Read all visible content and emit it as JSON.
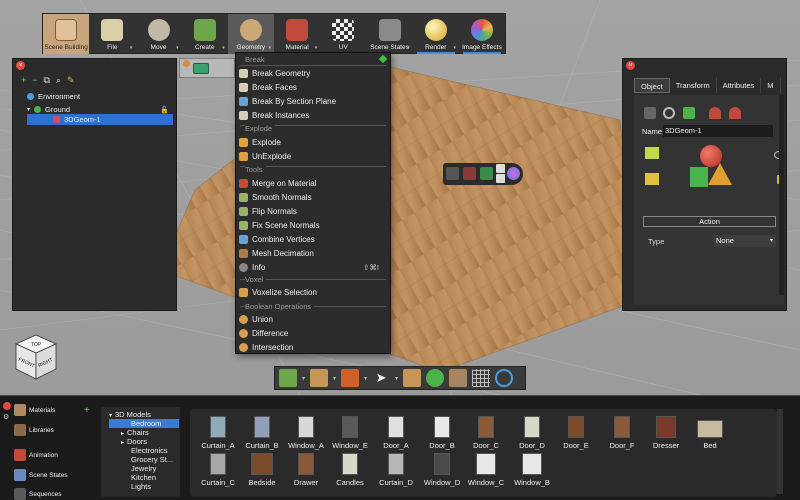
{
  "toolbar": {
    "items": [
      {
        "label": "Scene Building"
      },
      {
        "label": "File"
      },
      {
        "label": "Move"
      },
      {
        "label": "Create"
      },
      {
        "label": "Geometry"
      },
      {
        "label": "Material"
      },
      {
        "label": "UV"
      },
      {
        "label": "Scene States"
      },
      {
        "label": "Render"
      },
      {
        "label": "Image Effects"
      }
    ]
  },
  "scene": {
    "items": [
      {
        "label": "Environment"
      },
      {
        "label": "Ground"
      },
      {
        "label": "3DGeom-1"
      }
    ]
  },
  "menu": {
    "sections": [
      {
        "header": "Break",
        "items": [
          "Break Geometry",
          "Break Faces",
          "Break By Section Plane",
          "Break Instances"
        ]
      },
      {
        "header": "Explode",
        "items": [
          "Explode",
          "UnExplode"
        ]
      },
      {
        "header": "Tools",
        "items": [
          "Merge on Material",
          "Smooth Normals",
          "Flip Normals",
          "Fix Scene Normals",
          "Combine Vertices",
          "Mesh Decimation",
          "Info"
        ]
      },
      {
        "header": "Voxel",
        "items": [
          "Voxelize Selection"
        ]
      },
      {
        "header": "Boolean Operations",
        "items": [
          "Union",
          "Difference",
          "Intersection"
        ]
      }
    ],
    "info_shortcut": "⇧⌘I"
  },
  "props": {
    "tabs": [
      "Object",
      "Transform",
      "Attributes",
      "M"
    ],
    "name_label": "Name",
    "name_value": "3DGeom-1",
    "action_label": "Action",
    "type_label": "Type",
    "type_value": "None"
  },
  "navcube": {
    "top": "TOP",
    "front": "FRONT",
    "right": "RIGHT"
  },
  "dock": {
    "side": [
      "Materials",
      "Libraries",
      "Animation",
      "Scene States",
      "Sequences"
    ],
    "categories": [
      "3D Models",
      "Bedroom",
      "Chairs",
      "Doors",
      "Electronics",
      "Grocery St...",
      "Jewelry",
      "Kitchen",
      "Lights"
    ],
    "row1": [
      "Curtain_A",
      "Curtain_B",
      "Window_A",
      "Window_E",
      "Door_A",
      "Door_B",
      "Door_C",
      "Door_D",
      "Door_E",
      "Door_F",
      "Dresser",
      "Bed"
    ],
    "row2": [
      "Curtain_C",
      "Bedside",
      "Drawer",
      "Candles",
      "Curtain_D",
      "Window_D",
      "Window_C",
      "Window_B"
    ]
  },
  "colors": {
    "accent": "#c9a57e",
    "selection": "#2e6fd0",
    "close": "#e04b3f",
    "add": "#5fd35f"
  }
}
